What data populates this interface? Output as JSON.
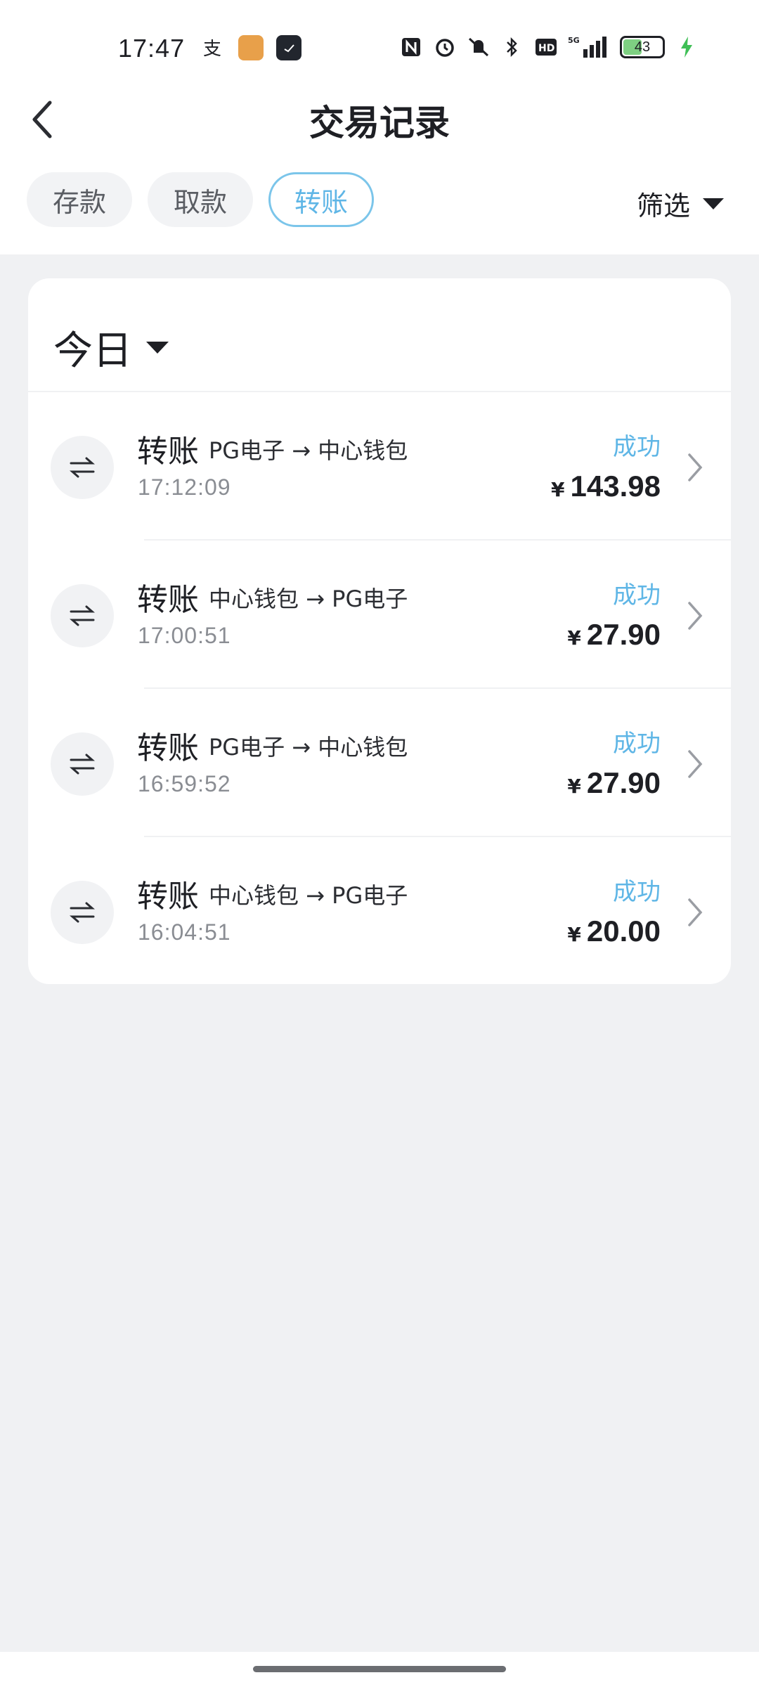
{
  "status_bar": {
    "time": "17:47",
    "battery": "43",
    "network": "5G",
    "hd": "HD"
  },
  "header": {
    "title": "交易记录"
  },
  "tabs": [
    {
      "label": "存款",
      "active": false
    },
    {
      "label": "取款",
      "active": false
    },
    {
      "label": "转账",
      "active": true
    }
  ],
  "filter_label": "筛选",
  "day_label": "今日",
  "records": [
    {
      "type": "转账",
      "route": "PG电子 → 中心钱包",
      "time": "17:12:09",
      "status": "成功",
      "currency": "¥",
      "amount": "143.98"
    },
    {
      "type": "转账",
      "route": "中心钱包 → PG电子",
      "time": "17:00:51",
      "status": "成功",
      "currency": "¥",
      "amount": "27.90"
    },
    {
      "type": "转账",
      "route": "PG电子 → 中心钱包",
      "time": "16:59:52",
      "status": "成功",
      "currency": "¥",
      "amount": "27.90"
    },
    {
      "type": "转账",
      "route": "中心钱包 → PG电子",
      "time": "16:04:51",
      "status": "成功",
      "currency": "¥",
      "amount": "20.00"
    }
  ],
  "colors": {
    "accent": "#5fb6e6",
    "background": "#f0f1f3",
    "text": "#1e1f24"
  }
}
